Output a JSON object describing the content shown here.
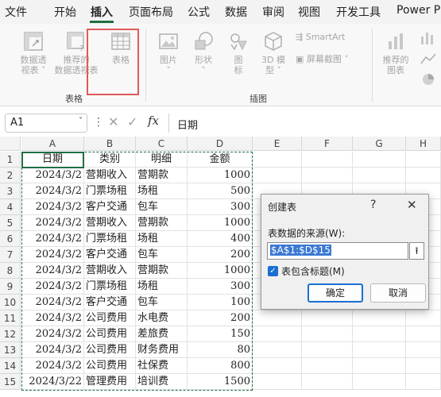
{
  "menu": {
    "items": [
      "文件",
      "开始",
      "插入",
      "页面布局",
      "公式",
      "数据",
      "审阅",
      "视图",
      "开发工具",
      "Power Pi"
    ],
    "active_index": 2
  },
  "ribbon": {
    "groups": {
      "tables": {
        "label": "表格",
        "buttons": [
          {
            "line1": "数据透",
            "line2": "视表 ˅"
          },
          {
            "line1": "推荐的",
            "line2": "数据透视表"
          },
          {
            "line1": "表格",
            "line2": ""
          }
        ]
      },
      "illustrations": {
        "label": "插图",
        "buttons": [
          {
            "line1": "图片",
            "line2": "˅"
          },
          {
            "line1": "形状",
            "line2": "˅"
          },
          {
            "line1": "图",
            "line2": "标"
          },
          {
            "line1": "3D 模",
            "line2": "型 ˅"
          }
        ],
        "smartart": "SmartArt",
        "screenshot": "屏幕截图 ˅"
      },
      "charts": {
        "buttons": [
          {
            "line1": "推荐的",
            "line2": "图表"
          }
        ]
      }
    }
  },
  "formula_bar": {
    "name_box": "A1",
    "fx": "fx",
    "content": "日期"
  },
  "grid": {
    "columns": [
      "A",
      "B",
      "C",
      "D",
      "E",
      "F",
      "G",
      "H"
    ],
    "rows": [
      [
        "日期",
        "类别",
        "明细",
        "金额"
      ],
      [
        "2024/3/2",
        "营期收入",
        "营期款",
        "1000"
      ],
      [
        "2024/3/2",
        "门票场租",
        "场租",
        "500"
      ],
      [
        "2024/3/2",
        "客户交通",
        "包车",
        "300"
      ],
      [
        "2024/3/2",
        "营期收入",
        "营期款",
        "1000"
      ],
      [
        "2024/3/2",
        "门票场租",
        "场租",
        "400"
      ],
      [
        "2024/3/2",
        "客户交通",
        "包车",
        "200"
      ],
      [
        "2024/3/2",
        "营期收入",
        "营期款",
        "1000"
      ],
      [
        "2024/3/2",
        "门票场租",
        "场租",
        "300"
      ],
      [
        "2024/3/2",
        "客户交通",
        "包车",
        "100"
      ],
      [
        "2024/3/2",
        "公司费用",
        "水电费",
        "200"
      ],
      [
        "2024/3/2",
        "公司费用",
        "差旅费",
        "150"
      ],
      [
        "2024/3/2",
        "公司费用",
        "财务费用",
        "80"
      ],
      [
        "2024/3/2",
        "公司费用",
        "社保费",
        "800"
      ],
      [
        "2024/3/22",
        "管理费用",
        "培训费",
        "1500"
      ]
    ]
  },
  "dialog": {
    "title": "创建表",
    "help": "?",
    "close": "✕",
    "source_label": "表数据的来源(W):",
    "range_value": "$A$1:$D$15",
    "collapse_icon": "⭱",
    "checkbox_label": "表包含标题(M)",
    "ok": "确定",
    "cancel": "取消"
  },
  "colors": {
    "accent": "#1f6e43",
    "highlight": "#e05a5a",
    "dialog_primary": "#1a6fd2"
  }
}
